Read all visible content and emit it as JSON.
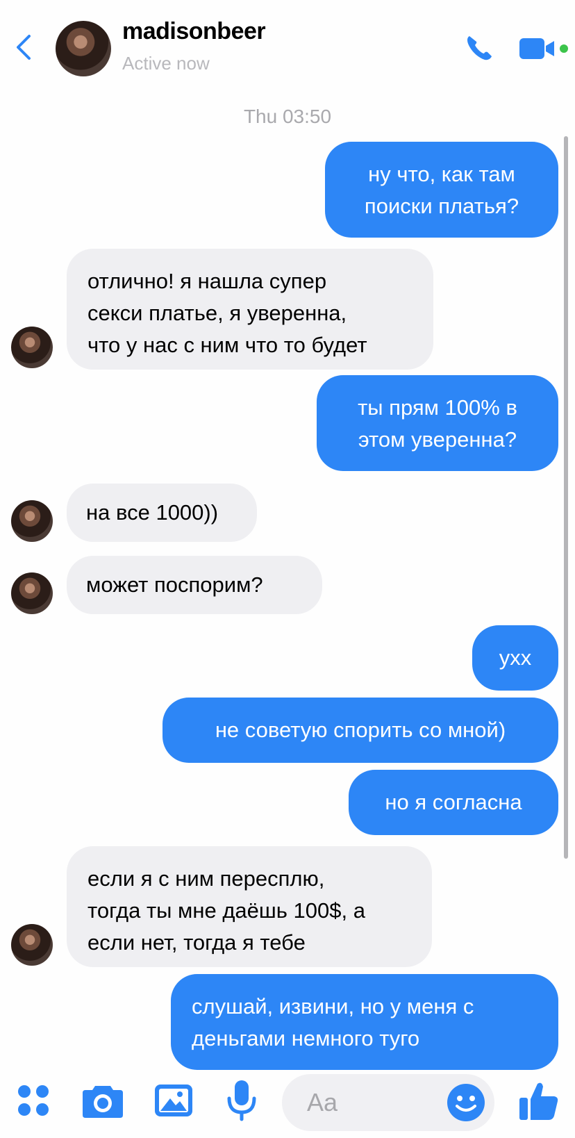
{
  "header": {
    "title": "madisonbeer",
    "subtitle": "Active now"
  },
  "timestamp": "Thu 03:50",
  "messages": [
    {
      "side": "out",
      "lines": [
        "ну что, как там",
        "поиски платья?"
      ]
    },
    {
      "side": "in",
      "lines": [
        "отлично! я нашла супер",
        "секси платье, я уверенна,",
        "что у нас с ним что то будет"
      ]
    },
    {
      "side": "out",
      "lines": [
        "ты прям 100% в",
        "этом уверенна?"
      ]
    },
    {
      "side": "in",
      "lines": [
        "на все 1000))"
      ]
    },
    {
      "side": "in",
      "lines": [
        "может поспорим?"
      ]
    },
    {
      "side": "out",
      "lines": [
        "ухх"
      ]
    },
    {
      "side": "out",
      "lines": [
        "не советую спорить со мной)"
      ]
    },
    {
      "side": "out",
      "lines": [
        "но я согласна"
      ]
    },
    {
      "side": "in",
      "lines": [
        "если я с ним пересплю,",
        "тогда ты мне даёшь 100$, а",
        "если нет, тогда я тебе"
      ]
    },
    {
      "side": "out",
      "lines": [
        "слушай, извини, но у меня с",
        "деньгами немного туго"
      ]
    }
  ],
  "composer": {
    "placeholder": "Aa"
  },
  "colors": {
    "accent": "#2d86f6",
    "incoming_bubble": "#efeff2",
    "muted_text": "#a9a9ad"
  },
  "icons": [
    "back-chevron-icon",
    "phone-icon",
    "video-call-icon",
    "apps-grid-icon",
    "camera-icon",
    "gallery-icon",
    "microphone-icon",
    "emoji-icon",
    "like-thumb-icon"
  ]
}
